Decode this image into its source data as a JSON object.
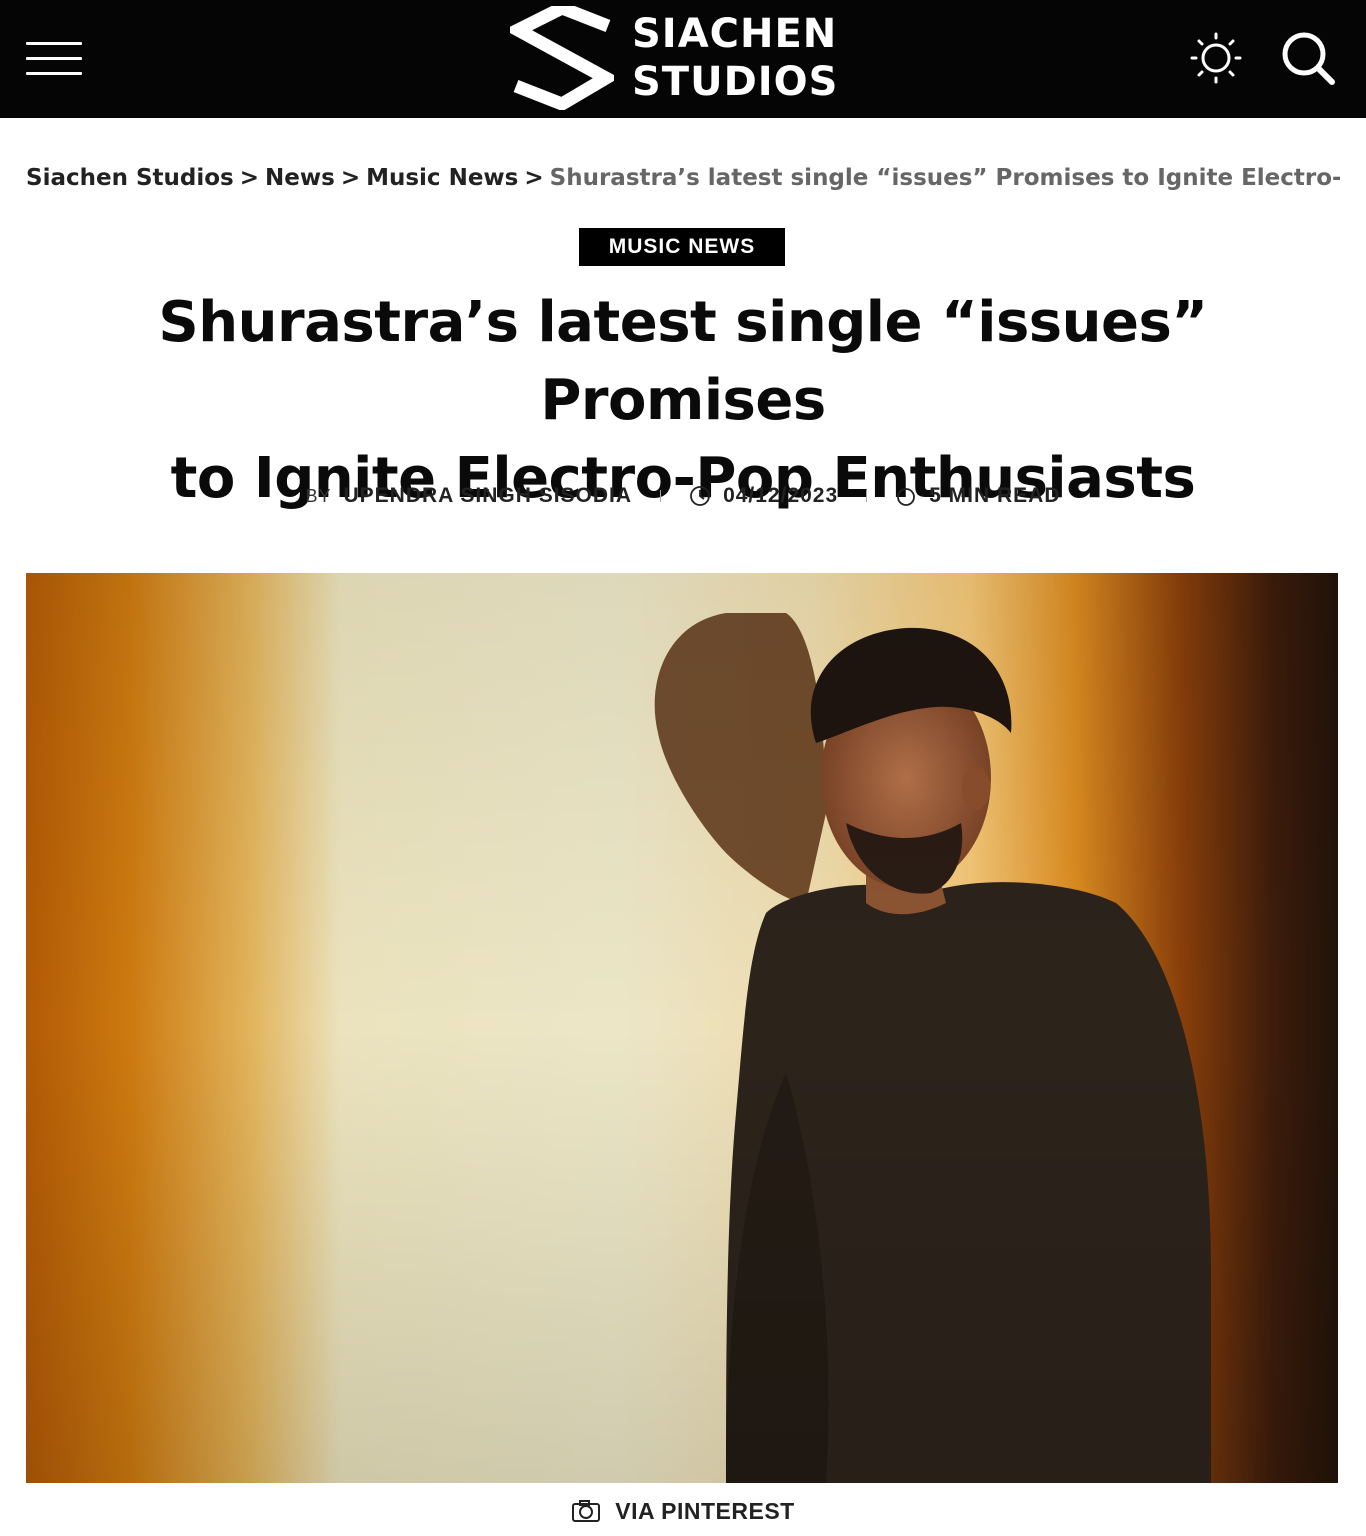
{
  "header": {
    "logo": {
      "line1": "SIACHEN",
      "line2": "STUDIOS"
    },
    "icons": {
      "menu": "hamburger-menu-icon",
      "theme": "sun-icon",
      "search": "search-icon"
    }
  },
  "breadcrumb": {
    "items": [
      "Siachen Studios",
      "News",
      "Music News"
    ],
    "separator": ">",
    "current": "Shurastra’s latest single “issues” Promises to Ignite Electro-P..."
  },
  "article": {
    "category": "MUSIC NEWS",
    "title_line1": "Shurastra’s latest single “issues” Promises",
    "title_line2": "to Ignite Electro-Pop Enthusiasts",
    "meta": {
      "by_label": "BY",
      "author": "UPENDRA SINGH SISODIA",
      "date": "04/12/2023",
      "read_time": "5 MIN READ"
    },
    "image": {
      "description_icon": "photo-of-man-looking-down",
      "credit": "VIA PINTEREST",
      "credit_icon": "camera-icon"
    }
  },
  "colors": {
    "header_bg": "#050505",
    "badge_bg": "#000000",
    "text": "#111111",
    "breadcrumb_current": "#666666"
  }
}
